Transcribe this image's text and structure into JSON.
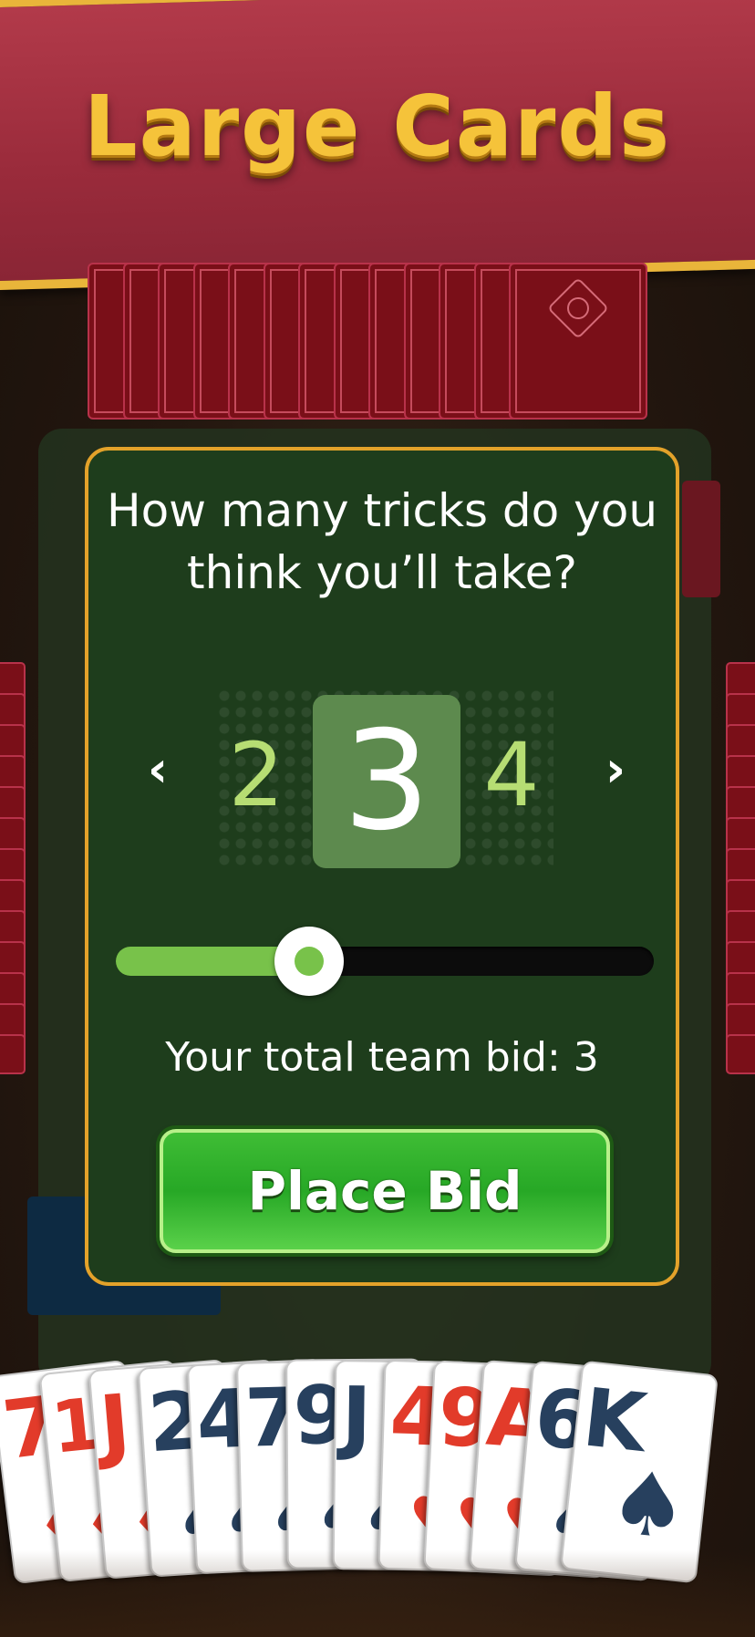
{
  "banner": {
    "title": "Large Cards"
  },
  "bid_dialog": {
    "question": "How many tricks do you think you’ll take?",
    "prev_arrow": "‹",
    "next_arrow": "›",
    "prev_value": "2",
    "selected_value": "3",
    "next_value": "4",
    "slider": {
      "value": 3,
      "min": 0,
      "max": 13
    },
    "team_bid_text": "Your total team bid: 3",
    "place_bid_label": "Place Bid"
  },
  "hand": [
    {
      "rank": "7",
      "suit": "♦",
      "color": "red"
    },
    {
      "rank": "10",
      "suit": "♦",
      "color": "red"
    },
    {
      "rank": "J",
      "suit": "♦",
      "color": "red"
    },
    {
      "rank": "2",
      "suit": "♠",
      "color": "navy"
    },
    {
      "rank": "4",
      "suit": "♠",
      "color": "navy"
    },
    {
      "rank": "7",
      "suit": "♠",
      "color": "navy"
    },
    {
      "rank": "9",
      "suit": "♠",
      "color": "navy"
    },
    {
      "rank": "J",
      "suit": "♠",
      "color": "navy"
    },
    {
      "rank": "4",
      "suit": "♥",
      "color": "red"
    },
    {
      "rank": "9",
      "suit": "♥",
      "color": "red"
    },
    {
      "rank": "A",
      "suit": "♥",
      "color": "red"
    },
    {
      "rank": "6",
      "suit": "♠",
      "color": "navy"
    },
    {
      "rank": "K",
      "suit": "♠",
      "color": "navy"
    }
  ],
  "colors": {
    "banner": "#9a2b3b",
    "banner_trim": "#e9b53a",
    "dialog_bg": "#1e3d1c",
    "accent_green": "#78c24a",
    "button_green": "#27a826"
  }
}
